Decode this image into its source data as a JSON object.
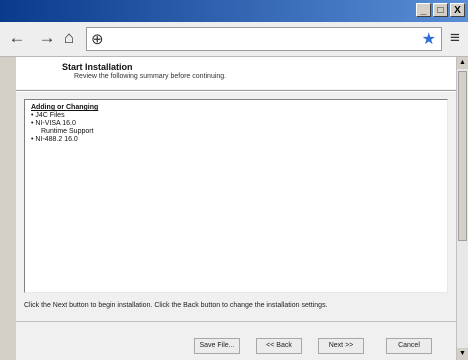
{
  "window": {
    "minimize_label": "_",
    "maximize_label": "□",
    "close_label": "X"
  },
  "browser": {
    "back_glyph": "←",
    "forward_glyph": "→",
    "home_glyph": "⌂",
    "url_value": "",
    "menu_glyph": "≡"
  },
  "installer": {
    "title": "Start Installation",
    "subtitle": "Review the following summary before continuing.",
    "summary_heading": "Adding or Changing",
    "items": [
      {
        "text": "• J4C Files",
        "level": 0
      },
      {
        "text": "• NI-VISA 16.0",
        "level": 0
      },
      {
        "text": "Runtime Support",
        "level": 1
      },
      {
        "text": "• NI-488.2 16.0",
        "level": 0
      }
    ],
    "instructions": "Click the Next button to begin installation.  Click the Back button to change the installation settings.",
    "buttons": {
      "save": "Save File...",
      "back": "<< Back",
      "next": "Next >>",
      "cancel": "Cancel"
    }
  }
}
